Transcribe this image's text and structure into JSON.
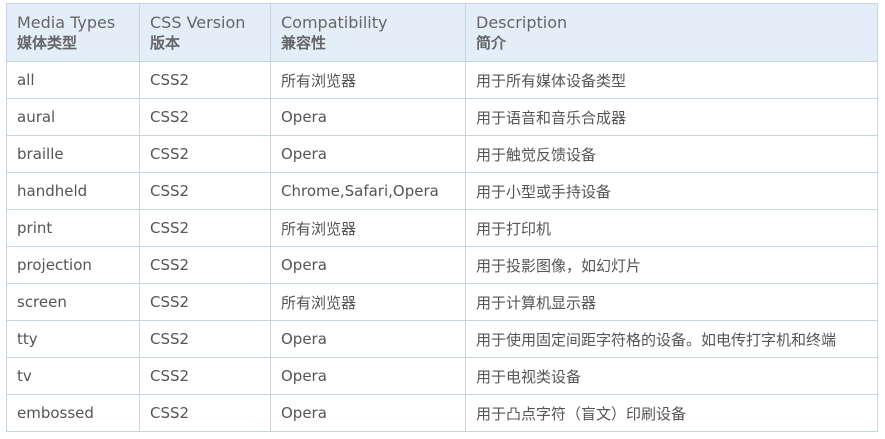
{
  "table": {
    "headers": [
      {
        "en": "Media Types",
        "zh": "媒体类型"
      },
      {
        "en": "CSS Version",
        "zh": "版本"
      },
      {
        "en": "Compatibility",
        "zh": "兼容性"
      },
      {
        "en": "Description",
        "zh": "简介"
      }
    ],
    "rows": [
      [
        "all",
        "CSS2",
        "所有浏览器",
        "用于所有媒体设备类型"
      ],
      [
        "aural",
        "CSS2",
        "Opera",
        "用于语音和音乐合成器"
      ],
      [
        "braille",
        "CSS2",
        "Opera",
        "用于触觉反馈设备"
      ],
      [
        "handheld",
        "CSS2",
        "Chrome,Safari,Opera",
        "用于小型或手持设备"
      ],
      [
        "print",
        "CSS2",
        "所有浏览器",
        "用于打印机"
      ],
      [
        "projection",
        "CSS2",
        "Opera",
        "用于投影图像，如幻灯片"
      ],
      [
        "screen",
        "CSS2",
        "所有浏览器",
        "用于计算机显示器"
      ],
      [
        "tty",
        "CSS2",
        "Opera",
        "用于使用固定间距字符格的设备。如电传打字机和终端"
      ],
      [
        "tv",
        "CSS2",
        "Opera",
        "用于电视类设备"
      ],
      [
        "embossed",
        "CSS2",
        "Opera",
        "用于凸点字符（盲文）印刷设备"
      ]
    ]
  }
}
